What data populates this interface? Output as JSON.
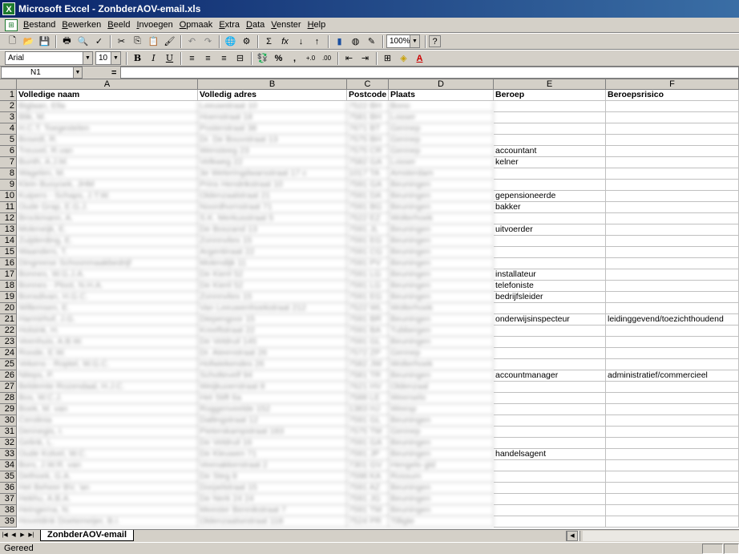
{
  "window": {
    "title": "Microsoft Excel - ZonbderAOV-email.xls"
  },
  "menu": [
    "Bestand",
    "Bewerken",
    "Beeld",
    "Invoegen",
    "Opmaak",
    "Extra",
    "Data",
    "Venster",
    "Help"
  ],
  "toolbar": {
    "zoom": "100%",
    "font": "Arial",
    "size": "10",
    "bold": "B",
    "italic": "I",
    "underline": "U",
    "percent": "%",
    "comma": ",",
    "sum": "Σ",
    "fx": "fx",
    "help": "?"
  },
  "formula_bar": {
    "name_box": "N1",
    "equals": "="
  },
  "columns": [
    "A",
    "B",
    "C",
    "D",
    "E",
    "F"
  ],
  "headers": [
    "Volledige naam",
    "Volledig adres",
    "Postcode",
    "Plaats",
    "Beroep",
    "Beroepsrisico"
  ],
  "rows": [
    {
      "n": "2",
      "a": "Biglaan, Ella",
      "b": "Leeuwstraat 10",
      "c": "7522 BH",
      "d": "Bono",
      "e": "",
      "f": ""
    },
    {
      "n": "3",
      "a": "Blik, M.",
      "b": "Hoenstraat 18",
      "c": "7581 BH",
      "d": "Losser",
      "e": "",
      "f": ""
    },
    {
      "n": "4",
      "a": "H.C.T. Toegestelen",
      "b": "Posterstraat 38",
      "c": "7671 BT",
      "d": "Gennep",
      "e": "",
      "f": ""
    },
    {
      "n": "5",
      "a": "Bosedt, R.",
      "b": "Dr. De Bouvstraat 13",
      "c": "7575 BH",
      "d": "Gennep",
      "e": "",
      "f": ""
    },
    {
      "n": "6",
      "a": "Treuvel, R.van",
      "b": "Wensteeg 23",
      "c": "7575 CR",
      "d": "Gennep",
      "e": "accountant",
      "f": ""
    },
    {
      "n": "7",
      "a": "Bunth, A.J.M.",
      "b": "Velkweg 22",
      "c": "7582 GA",
      "d": "Losser",
      "e": "kelner",
      "f": ""
    },
    {
      "n": "8",
      "a": "Wagelen, M.",
      "b": "3e Weteringdwarsstraat 17 c",
      "c": "1017 TA",
      "d": "Amsterdam",
      "e": "",
      "f": ""
    },
    {
      "n": "9",
      "a": "Klein Buoyoek, JHM",
      "b": "Prins Hendrikstraat 10",
      "c": "7591 GA",
      "d": "Beuningen",
      "e": "",
      "f": ""
    },
    {
      "n": "10",
      "a": "Kuipers - Schaps, J.T.W.",
      "b": "Oldenzaalstraat 21",
      "c": "7591 DA",
      "d": "Beuningen",
      "e": "gepensioneerde",
      "f": ""
    },
    {
      "n": "11",
      "a": "Oude Grap, E.G.J.",
      "b": "Noordhornstraat 71",
      "c": "7591 BG",
      "d": "Beuningen",
      "e": "bakker",
      "f": ""
    },
    {
      "n": "12",
      "a": "Brockmann, A.",
      "b": "S.K. Merkusstraat 5",
      "c": "7522 EZ",
      "d": "Wolterhoek",
      "e": "",
      "f": ""
    },
    {
      "n": "13",
      "a": "Moleneijk, E.",
      "b": "De Boszand 13",
      "c": "7591 JL",
      "d": "Beuningen",
      "e": "uitvoerder",
      "f": ""
    },
    {
      "n": "14",
      "a": "Zuijderding, E.",
      "b": "Zonnnvlies 15",
      "c": "7591 EG",
      "d": "Beuningen",
      "e": "",
      "f": ""
    },
    {
      "n": "15",
      "a": "Waanders, T.",
      "b": "Argentinaat 22",
      "c": "7591 CG",
      "d": "Beuningen",
      "e": "",
      "f": ""
    },
    {
      "n": "16",
      "a": "Dingreese Schoonmaakbedrijf",
      "b": "Molendijk 11",
      "c": "7591 PV",
      "d": "Beuningen",
      "e": "",
      "f": ""
    },
    {
      "n": "17",
      "a": "Bonnes, W.G.J.A.",
      "b": "De Kieril 52",
      "c": "7591 LG",
      "d": "Beuningen",
      "e": "installateur",
      "f": ""
    },
    {
      "n": "18",
      "a": "Bonnes - Ploot, N.H.A.",
      "b": "De Kieril 52",
      "c": "7591 LG",
      "d": "Beuningen",
      "e": "telefoniste",
      "f": ""
    },
    {
      "n": "19",
      "a": "Bonsdivan, H.G.C.",
      "b": "Zonnnvlies 15",
      "c": "7591 EG",
      "d": "Beuningen",
      "e": "bedrijfsleider",
      "f": ""
    },
    {
      "n": "20",
      "a": "Willemsen, E.",
      "b": "Van Leeuwenhoekstraat 212",
      "c": "7522 WL",
      "d": "Wolterhoek",
      "e": "",
      "f": ""
    },
    {
      "n": "21",
      "a": "Harmirhof, J.G.",
      "b": "Diepengoor 15",
      "c": "7591 BR",
      "d": "Beuningen",
      "e": "onderwijsinspecteur",
      "f": "leidinggevend/toezichthoudend"
    },
    {
      "n": "22",
      "a": "Holsink, H.",
      "b": "Kreeftstraat 22",
      "c": "7591 BA",
      "d": "Tubbergen",
      "e": "",
      "f": ""
    },
    {
      "n": "23",
      "a": "Veenhuis, A.B.W.",
      "b": "De Veldruil 145",
      "c": "7591 GL",
      "d": "Beuningen",
      "e": "",
      "f": ""
    },
    {
      "n": "24",
      "a": "Roode, E.W.",
      "b": "Dr. Ateenstraat 26",
      "c": "7572 ZP",
      "d": "Gennep",
      "e": "",
      "f": ""
    },
    {
      "n": "25",
      "a": "Vekens - Roptel, W.G.C.",
      "b": "Hofwiekendes 26",
      "c": "7582 JW",
      "d": "Wolterhoek",
      "e": "",
      "f": ""
    },
    {
      "n": "26",
      "a": "Niteps, P.",
      "b": "Scholtevelf 94",
      "c": "7581 TR",
      "d": "Beuningen",
      "e": "accountmanager",
      "f": "administratief/commercieel"
    },
    {
      "n": "27",
      "a": "Beldemte Rozendaal, H.J.C.",
      "b": "Weijkuoerstraat 8",
      "c": "7621 HV",
      "d": "Oldenzaal",
      "e": "",
      "f": ""
    },
    {
      "n": "28",
      "a": "Bos, W.C.J.",
      "b": "Het Stift 6a",
      "c": "7588 LE",
      "d": "Weerselo",
      "e": "",
      "f": ""
    },
    {
      "n": "29",
      "a": "Boek, M. van",
      "b": "Roggenveelde 152",
      "c": "1383 HJ",
      "d": "Weesp",
      "e": "",
      "f": ""
    },
    {
      "n": "30",
      "a": "Cerolinia",
      "b": "Dallingstraat 12",
      "c": "7591 GL",
      "d": "Beuningen",
      "e": "",
      "f": ""
    },
    {
      "n": "31",
      "a": "Dennegis, I.",
      "b": "Pieterskampstraat 183",
      "c": "7575 TM",
      "d": "Gennep",
      "e": "",
      "f": ""
    },
    {
      "n": "32",
      "a": "Gelink, L.",
      "b": "De Veldruil 16",
      "c": "7591 GA",
      "d": "Beuningen",
      "e": "",
      "f": ""
    },
    {
      "n": "33",
      "a": "Oude Kolvel, W.C.",
      "b": "De Kleuwen 71",
      "c": "7591 JP",
      "d": "Beuningen",
      "e": "handelsagent",
      "f": ""
    },
    {
      "n": "34",
      "a": "Bors, J.W.R. van",
      "b": "Veenakkerstraat 2",
      "c": "7301 GV",
      "d": "Hengelo gld",
      "e": "",
      "f": ""
    },
    {
      "n": "35",
      "a": "Dethoek, G.A.",
      "b": "De Steg 8",
      "c": "7598 KA",
      "d": "Rossum",
      "e": "",
      "f": ""
    },
    {
      "n": "36",
      "a": "Het Beheer BV, 'an",
      "b": "Dorpelstraat 15",
      "c": "7591 AZ",
      "d": "Beuningen",
      "e": "",
      "f": ""
    },
    {
      "n": "37",
      "a": "Hekhu, A.B.A.",
      "b": "De Nerk 24 24",
      "c": "7591 JG",
      "d": "Beuningen",
      "e": "",
      "f": ""
    },
    {
      "n": "38",
      "a": "Heingerna, N.",
      "b": "Meester Bennikstraat 7",
      "c": "7591 TM",
      "d": "Beuningen",
      "e": "",
      "f": ""
    },
    {
      "n": "39",
      "a": "Hoveldink Doetemeijer, B.I.",
      "b": "Oldenzaalsestraat 118",
      "c": "7524 PR",
      "d": "Tilligte",
      "e": "",
      "f": ""
    }
  ],
  "sheet_tab": "ZonbderAOV-email",
  "status": "Gereed"
}
